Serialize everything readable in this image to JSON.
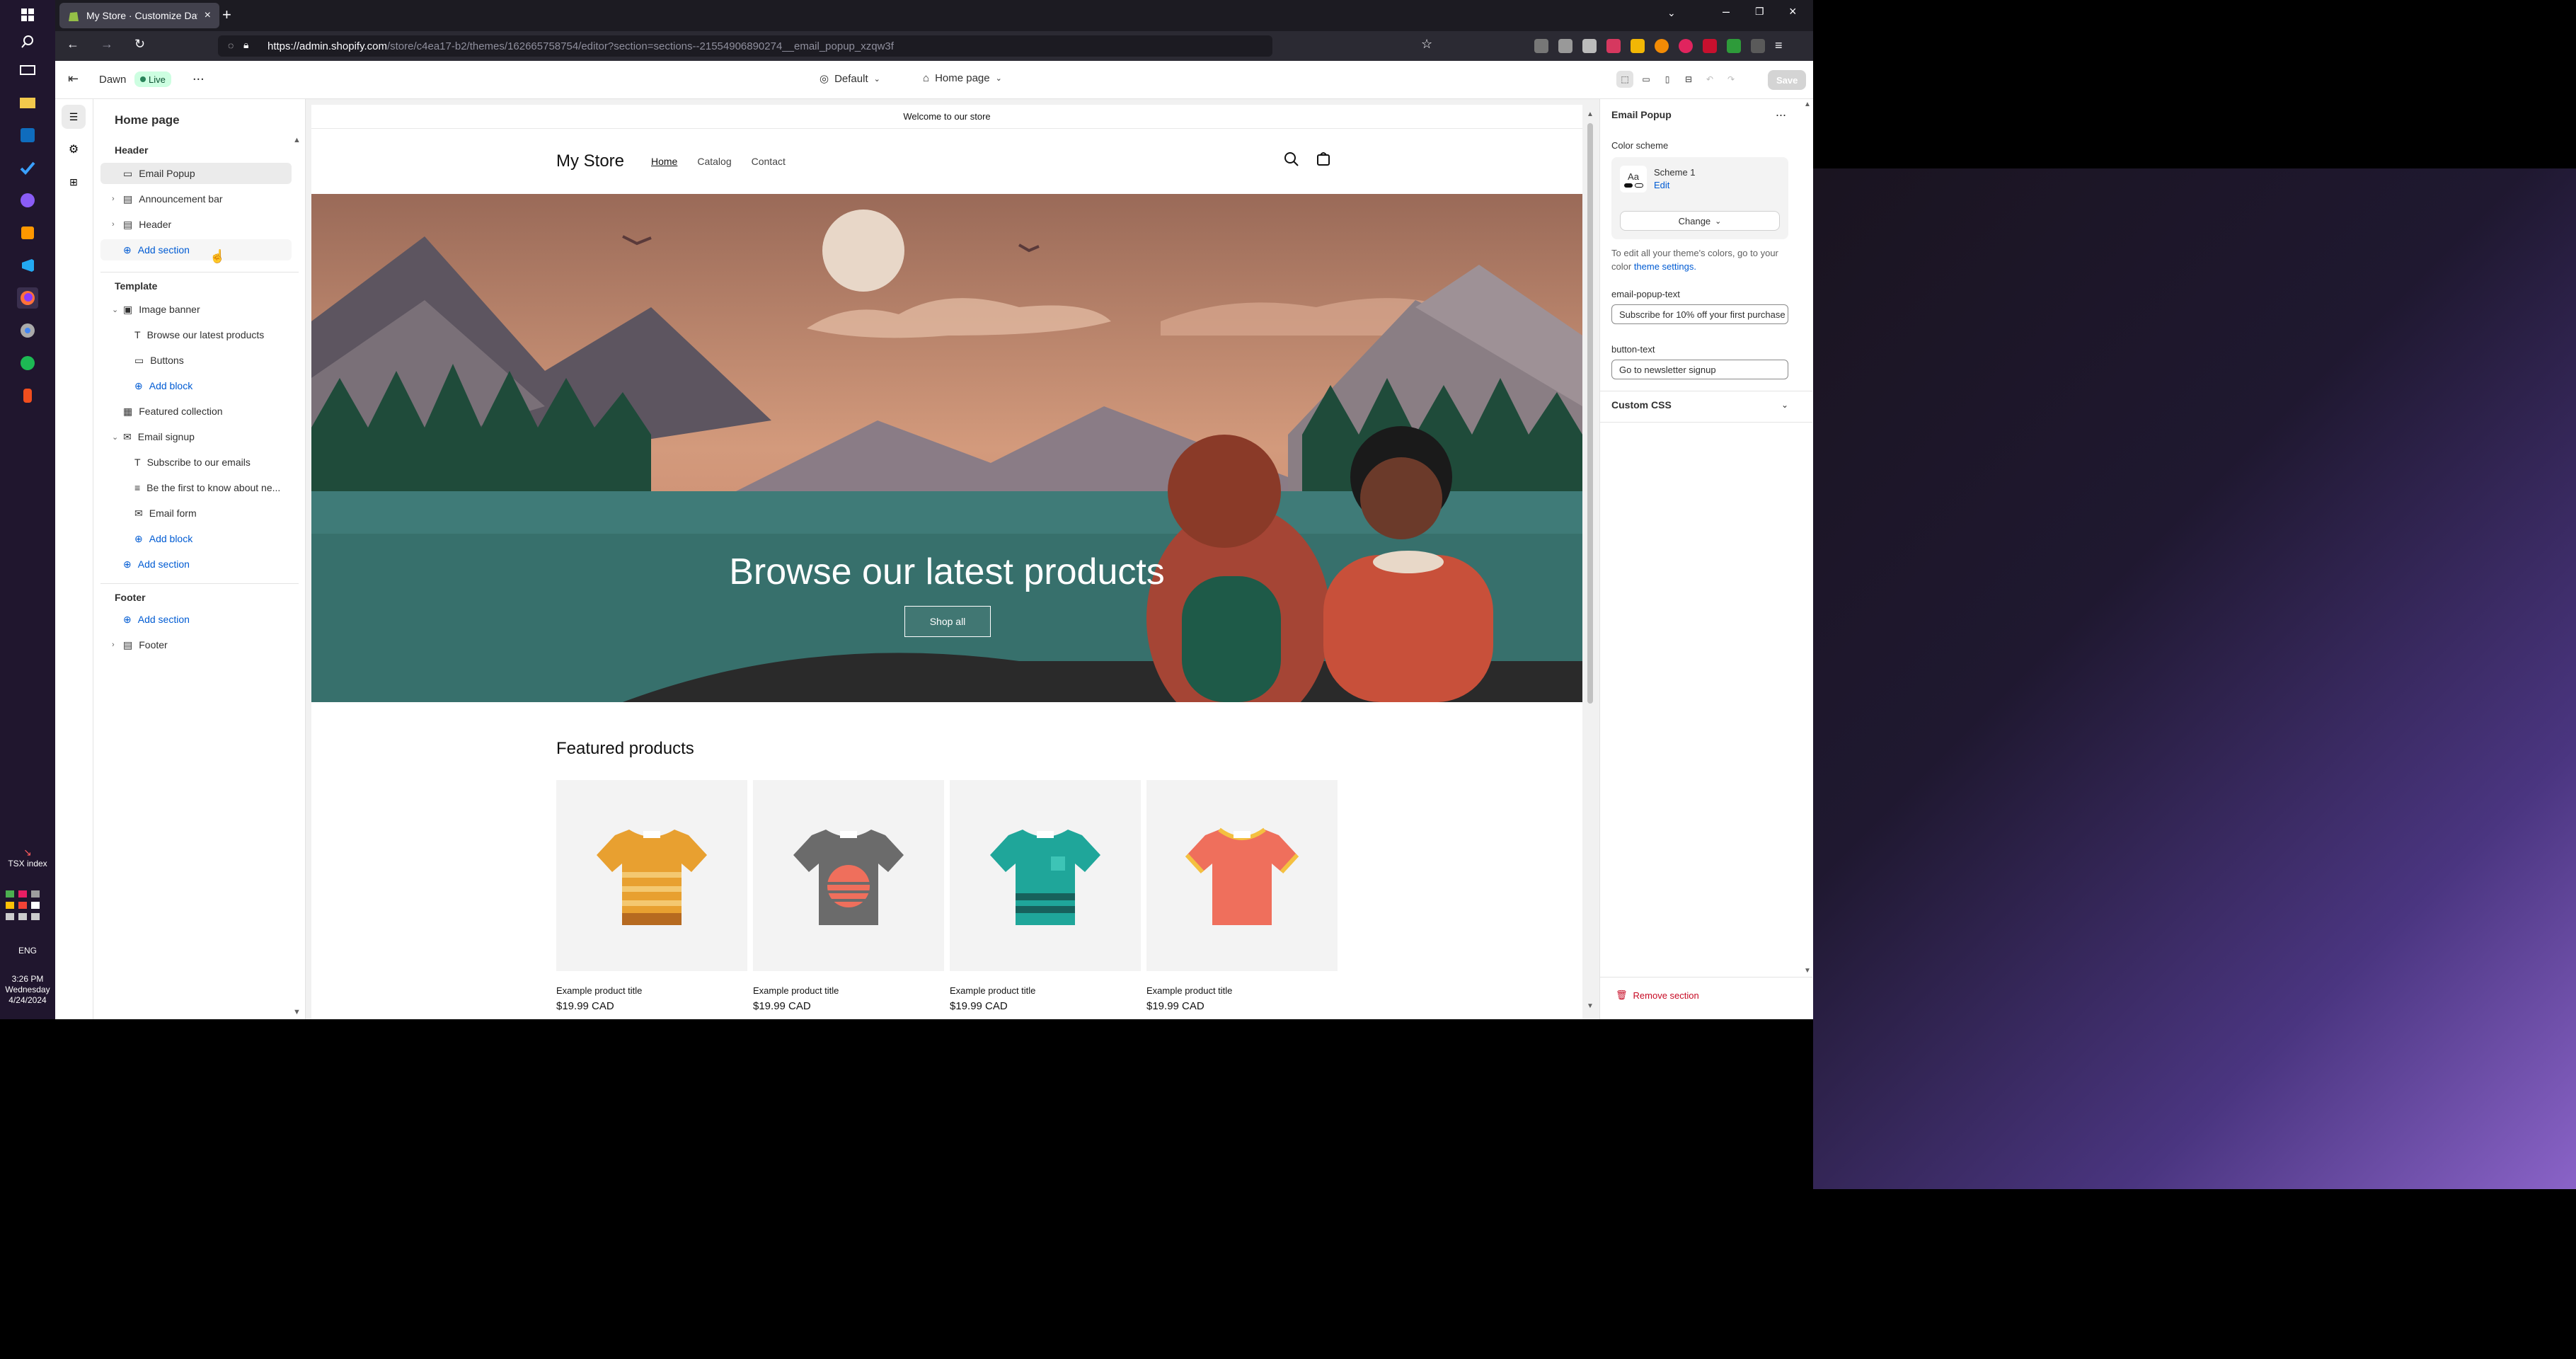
{
  "browser": {
    "tab_title": "My Store · Customize Dawn · Sh",
    "url_domain": "https://admin.shopify.com",
    "url_path": "/store/c4ea17-b2/themes/162665758754/editor?section=sections--21554906890274__email_popup_xzqw3f"
  },
  "appbar": {
    "theme_name": "Dawn",
    "live_badge": "Live",
    "more": "...",
    "preset": "Default",
    "page": "Home page",
    "save": "Save"
  },
  "left": {
    "title": "Home page",
    "header_group": "Header",
    "header_items": [
      "Email Popup",
      "Announcement bar",
      "Header"
    ],
    "add_section": "Add section",
    "template_group": "Template",
    "image_banner": "Image banner",
    "image_banner_blocks": [
      "Browse our latest products",
      "Buttons"
    ],
    "add_block": "Add block",
    "featured_collection": "Featured collection",
    "email_signup": "Email signup",
    "email_signup_blocks": [
      "Subscribe to our emails",
      "Be the first to know about ne...",
      "Email form"
    ],
    "footer_group": "Footer",
    "footer_item": "Footer"
  },
  "right": {
    "title": "Email Popup",
    "more": "...",
    "color_scheme_label": "Color scheme",
    "swatch_text": "Aa",
    "scheme_name": "Scheme 1",
    "edit": "Edit",
    "change": "Change",
    "help_text": "To edit all your theme's colors, go to your color",
    "help_link": "theme settings.",
    "field1_label": "email-popup-text",
    "field1_value": "Subscribe for 10% off your first purchase",
    "field2_label": "button-text",
    "field2_value": "Go to newsletter signup",
    "custom_css": "Custom CSS",
    "remove": "Remove section"
  },
  "store": {
    "announcement": "Welcome to our store",
    "logo": "My Store",
    "nav": [
      "Home",
      "Catalog",
      "Contact"
    ],
    "banner_heading": "Browse our latest products",
    "banner_button": "Shop all",
    "featured_heading": "Featured products",
    "products": [
      {
        "title": "Example product title",
        "price": "$19.99 CAD",
        "color": "#e8a030"
      },
      {
        "title": "Example product title",
        "price": "$19.99 CAD",
        "color": "#6b6b6b"
      },
      {
        "title": "Example product title",
        "price": "$19.99 CAD",
        "color": "#1fa69a"
      },
      {
        "title": "Example product title",
        "price": "$19.99 CAD",
        "color": "#ef6f5c"
      }
    ]
  },
  "taskbar": {
    "widget": "TSX index",
    "lang": "ENG",
    "time": "3:26 PM",
    "day": "Wednesday",
    "date": "4/24/2024"
  }
}
